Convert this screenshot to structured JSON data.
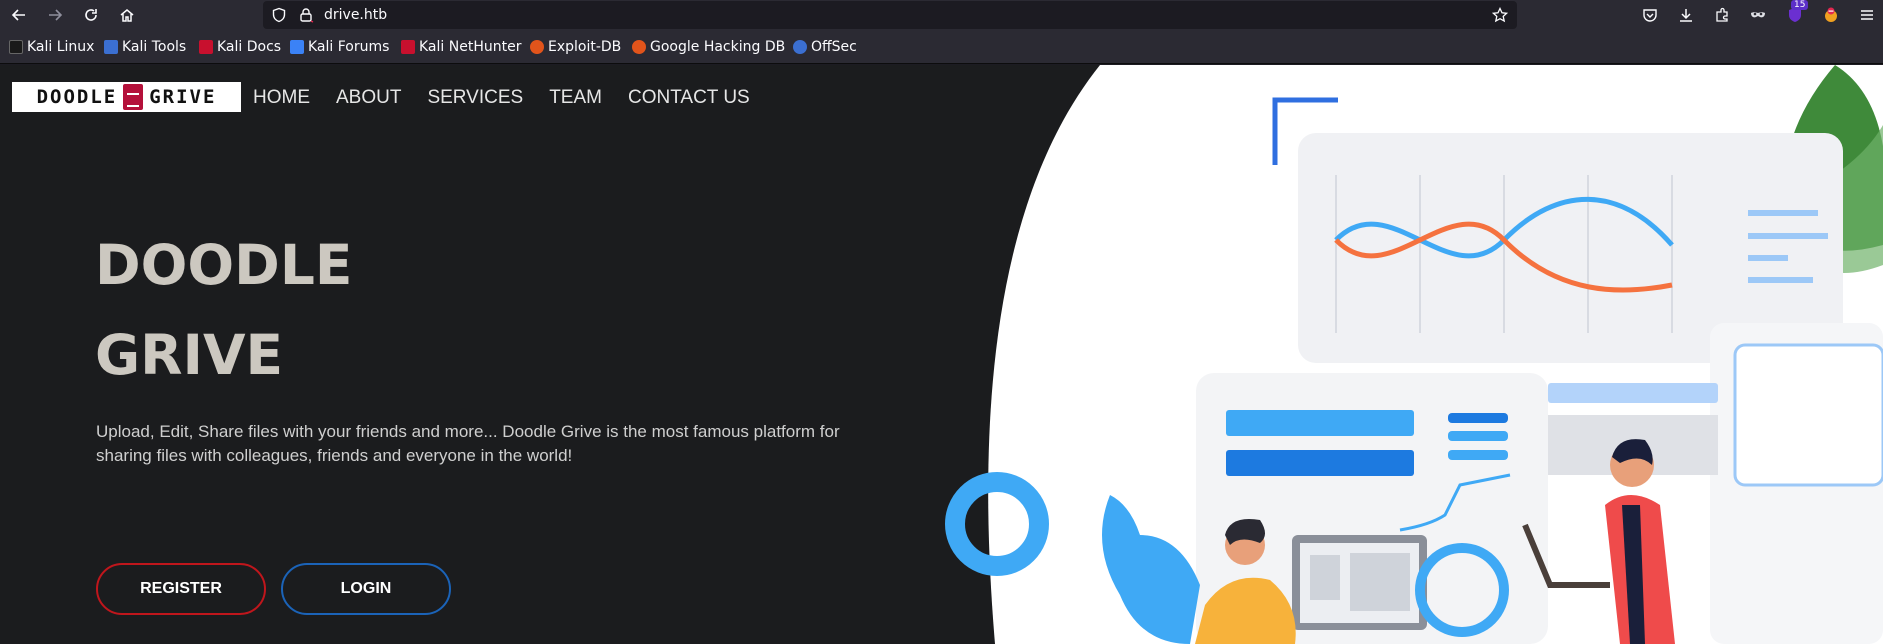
{
  "browser": {
    "url": "drive.htb",
    "extension_badge": "15",
    "icons": [
      "back-icon",
      "forward-icon",
      "reload-icon",
      "home-icon",
      "shield-icon",
      "lock-icon",
      "star-icon",
      "pocket-icon",
      "download-icon",
      "extensions-icon",
      "mask-icon",
      "ublock-icon",
      "profile-icon",
      "menu-icon"
    ]
  },
  "bookmarks": [
    {
      "label": "Kali Linux",
      "color": "#1a1a1a"
    },
    {
      "label": "Kali Tools",
      "color": "#3b6fd1"
    },
    {
      "label": "Kali Docs",
      "color": "#c8102e"
    },
    {
      "label": "Kali Forums",
      "color": "#3b82f6"
    },
    {
      "label": "Kali NetHunter",
      "color": "#c8102e"
    },
    {
      "label": "Exploit-DB",
      "color": "#e2541b"
    },
    {
      "label": "Google Hacking DB",
      "color": "#e2541b"
    },
    {
      "label": "OffSec",
      "color": "#3b6fd1"
    }
  ],
  "site": {
    "logo_text_left": "DOODLE",
    "logo_text_right": "GRIVE",
    "nav": [
      "HOME",
      "ABOUT",
      "SERVICES",
      "TEAM",
      "CONTACT US"
    ],
    "hero_title_line1": "DOODLE",
    "hero_title_line2": "GRIVE",
    "hero_description": "Upload, Edit, Share files with your friends and more... Doodle Grive is the most famous platform for sharing files with colleagues, friends and everyone in the world!",
    "register_label": "REGISTER",
    "login_label": "LOGIN"
  },
  "colors": {
    "page_bg": "#1b1c1e",
    "register_border": "#c0161c",
    "login_border": "#1b63b8",
    "chrome_bg": "#2b2a33"
  }
}
